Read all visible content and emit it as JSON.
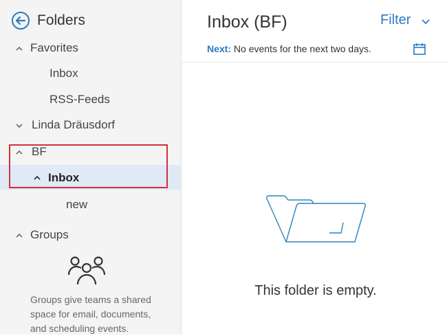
{
  "sidebar": {
    "title": "Folders",
    "tree": {
      "favorites": {
        "label": "Favorites",
        "children": [
          "Inbox",
          "RSS-Feeds"
        ]
      },
      "account": {
        "label": "Linda Dräusdorf"
      },
      "bf": {
        "label": "BF",
        "inbox_label": "Inbox",
        "inbox_children": [
          "new"
        ]
      },
      "groups": {
        "label": "Groups",
        "description": [
          "Groups give teams a shared",
          "space for email, documents,",
          "and scheduling events."
        ]
      }
    }
  },
  "main": {
    "title": "Inbox (BF)",
    "filter_label": "Filter",
    "next_label": "Next:",
    "next_text": "No events for the next two days.",
    "empty_message": "This folder is empty."
  },
  "colors": {
    "accent": "#2b7bc0",
    "highlight": "#dfeaf6",
    "annotation": "#d32f3a"
  },
  "icons": [
    "back-arrow-icon",
    "chevron-up-icon",
    "chevron-down-icon",
    "calendar-icon",
    "groups-icon",
    "empty-folder-icon"
  ]
}
